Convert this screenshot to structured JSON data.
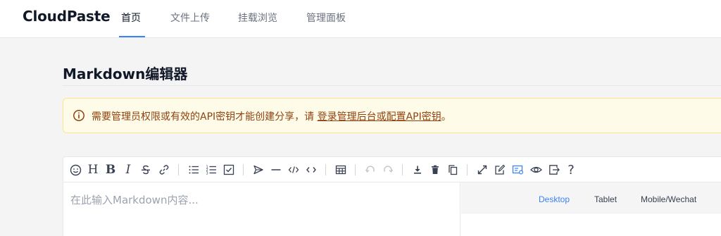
{
  "nav": {
    "brand": "CloudPaste",
    "items": [
      {
        "label": "首页",
        "active": true
      },
      {
        "label": "文件上传",
        "active": false
      },
      {
        "label": "挂载浏览",
        "active": false
      },
      {
        "label": "管理面板",
        "active": false
      }
    ]
  },
  "page": {
    "title": "Markdown编辑器"
  },
  "alert": {
    "text": "需要管理员权限或有效的API密钥才能创建分享，请 ",
    "link": "登录管理后台或配置API密钥",
    "suffix": "。"
  },
  "editor": {
    "placeholder": "在此输入Markdown内容...",
    "toolbar": [
      "emoji-icon",
      "heading-icon",
      "bold-icon",
      "italic-icon",
      "strikethrough-icon",
      "link-icon",
      "unordered-list-icon",
      "ordered-list-icon",
      "checklist-icon",
      "quote-icon",
      "horizontal-rule-icon",
      "code-icon",
      "inline-code-icon",
      "table-icon",
      "undo-icon",
      "redo-icon",
      "download-icon",
      "delete-icon",
      "copy-icon",
      "fullscreen-icon",
      "edit-mode-icon",
      "split-mode-icon",
      "preview-icon",
      "exit-icon",
      "help-icon"
    ],
    "toolbar_text": {
      "heading": "H",
      "bold": "B",
      "italic": "I",
      "question": "?"
    },
    "preview_tabs": [
      {
        "label": "Desktop",
        "active": true
      },
      {
        "label": "Tablet",
        "active": false
      },
      {
        "label": "Mobile/Wechat",
        "active": false
      }
    ]
  },
  "colors": {
    "accent": "#3b82f6",
    "alert_bg": "#fefce8",
    "alert_text": "#92400e"
  }
}
